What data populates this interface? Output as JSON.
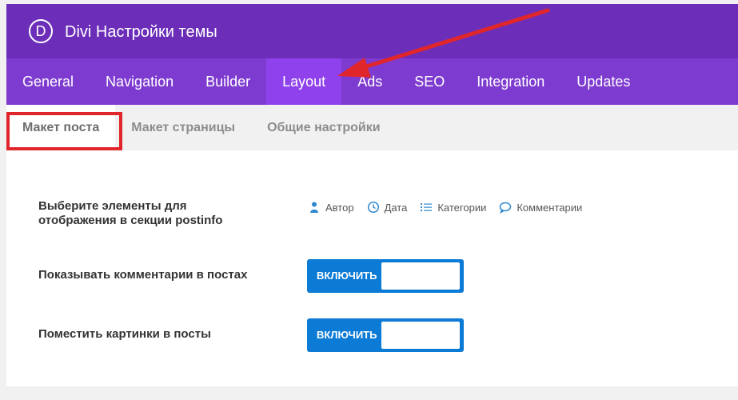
{
  "app": {
    "title": "Divi Настройки темы",
    "logo_letter": "D"
  },
  "tabs": [
    {
      "label": "General"
    },
    {
      "label": "Navigation"
    },
    {
      "label": "Builder"
    },
    {
      "label": "Layout",
      "active": true
    },
    {
      "label": "Ads"
    },
    {
      "label": "SEO"
    },
    {
      "label": "Integration"
    },
    {
      "label": "Updates"
    }
  ],
  "subtabs": [
    {
      "label": "Макет поста",
      "active": true
    },
    {
      "label": "Макет страницы"
    },
    {
      "label": "Общие настройки"
    }
  ],
  "settings": {
    "postinfo": {
      "label_line1": "Выберите элементы для",
      "label_line2": "отображения в секции postinfo",
      "options": [
        {
          "label": "Автор",
          "icon": "user-icon"
        },
        {
          "label": "Дата",
          "icon": "clock-icon"
        },
        {
          "label": "Категории",
          "icon": "list-icon"
        },
        {
          "label": "Комментарии",
          "icon": "comment-icon"
        }
      ]
    },
    "show_comments": {
      "label": "Показывать комментарии в постах",
      "toggle": "ВКЛЮЧИТЬ"
    },
    "place_images": {
      "label": "Поместить картинки в посты",
      "toggle": "ВКЛЮЧИТЬ"
    }
  },
  "colors": {
    "header": "#6c2eb9",
    "tabs": "#7e3bd0",
    "active_tab": "#8f42ec",
    "toggle": "#0c7bd6",
    "annotation": "#e0262b"
  }
}
